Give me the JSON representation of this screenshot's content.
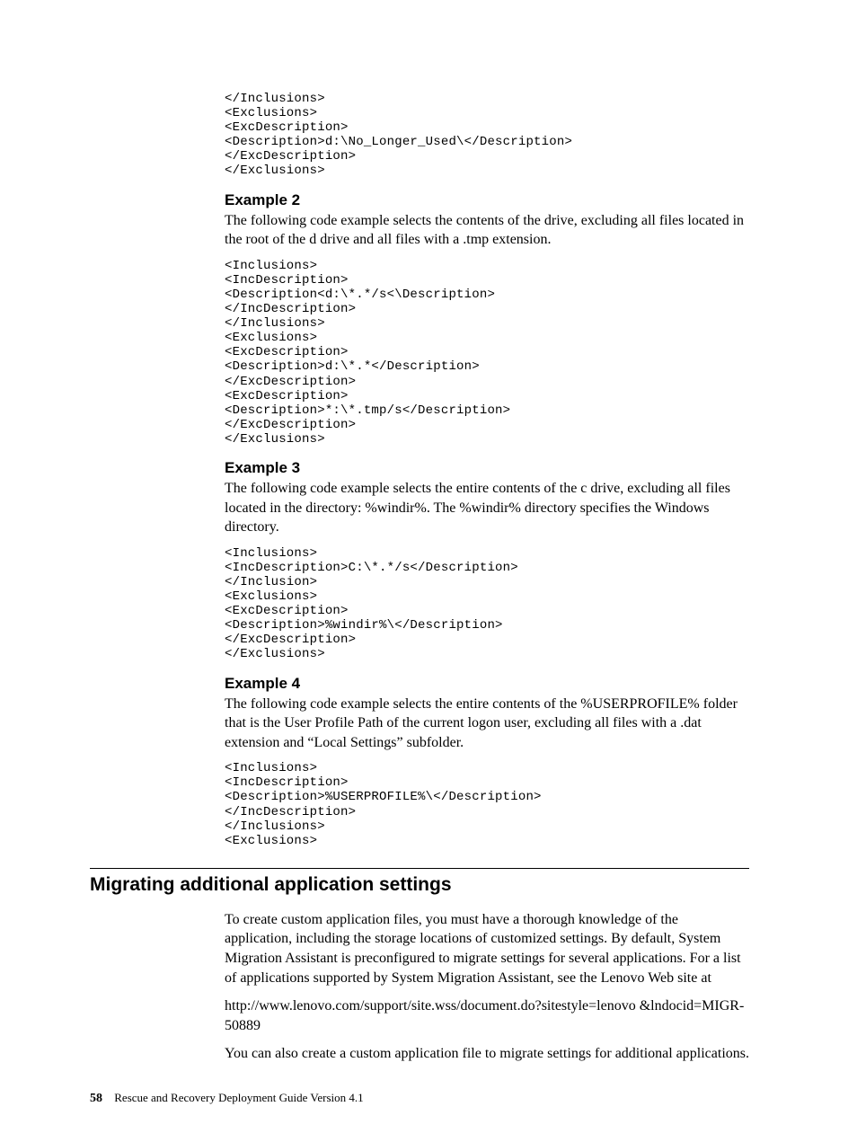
{
  "code1": "</Inclusions>\n<Exclusions>\n<ExcDescription>\n<Description>d:\\No_Longer_Used\\</Description>\n</ExcDescription>\n</Exclusions>",
  "ex2": {
    "heading": "Example 2",
    "body": "The following code example selects the contents of the drive, excluding all files located in the root of the d drive and all files with a .tmp extension.",
    "code": "<Inclusions>\n<IncDescription>\n<Description<d:\\*.*/s<\\Description>\n</IncDescription>\n</Inclusions>\n<Exclusions>\n<ExcDescription>\n<Description>d:\\*.*</Description>\n</ExcDescription>\n<ExcDescription>\n<Description>*:\\*.tmp/s</Description>\n</ExcDescription>\n</Exclusions>"
  },
  "ex3": {
    "heading": "Example 3",
    "body": "The following code example selects the entire contents of the c drive, excluding all files located in the directory: %windir%. The %windir% directory specifies the Windows directory.",
    "code": "<Inclusions>\n<IncDescription>C:\\*.*/s</Description>\n</Inclusion>\n<Exclusions>\n<ExcDescription>\n<Description>%windir%\\</Description>\n</ExcDescription>\n</Exclusions>"
  },
  "ex4": {
    "heading": "Example 4",
    "body": "The following code example selects the entire contents of the %USERPROFILE% folder that is the User Profile Path of the current logon user, excluding all files with a .dat extension and “Local Settings” subfolder.",
    "code": "<Inclusions>\n<IncDescription>\n<Description>%USERPROFILE%\\</Description>\n</IncDescription>\n</Inclusions>\n<Exclusions>"
  },
  "section": {
    "heading": "Migrating additional application settings",
    "p1": "To create custom application files, you must have a thorough knowledge of the application, including the storage locations of customized settings. By default, System Migration Assistant is preconfigured to migrate settings for several applications. For a list of applications supported by System Migration Assistant, see the Lenovo Web site at",
    "p2": "http://www.lenovo.com/support/site.wss/document.do?sitestyle=lenovo &lndocid=MIGR-50889",
    "p3": "You can also create a custom application file to migrate settings for additional applications."
  },
  "footer": {
    "page": "58",
    "text": "Rescue and Recovery Deployment Guide Version 4.1"
  }
}
